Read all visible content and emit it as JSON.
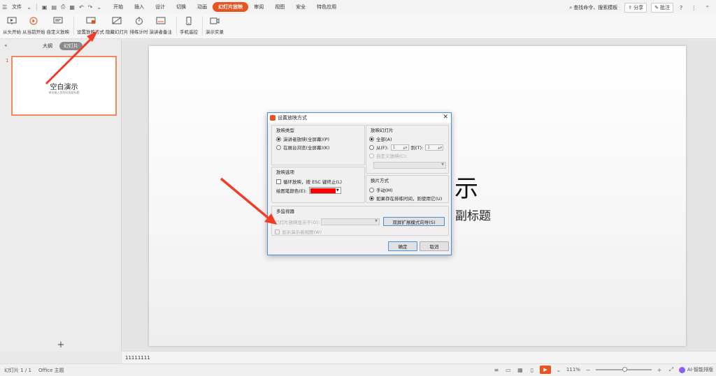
{
  "menubar": {
    "file_label": "文件",
    "tabs": [
      {
        "label": "开始",
        "active": false
      },
      {
        "label": "插入",
        "active": false
      },
      {
        "label": "设计",
        "active": false
      },
      {
        "label": "切换",
        "active": false
      },
      {
        "label": "动画",
        "active": false
      },
      {
        "label": "幻灯片放映",
        "active": true
      },
      {
        "label": "审阅",
        "active": false
      },
      {
        "label": "视图",
        "active": false
      },
      {
        "label": "安全",
        "active": false
      },
      {
        "label": "特色应用",
        "active": false
      }
    ],
    "search_label": "查找命令、搜索模板",
    "share_label": "分享",
    "comment_label": "批注"
  },
  "ribbon": {
    "buttons": [
      {
        "label": "从头开始",
        "icon": "play-from-start-icon"
      },
      {
        "label": "从当前开始",
        "icon": "play-current-icon"
      },
      {
        "label": "自定义放映",
        "icon": "custom-show-icon"
      },
      {
        "label": "设置放映方式",
        "icon": "setup-show-icon"
      },
      {
        "label": "隐藏幻灯片",
        "icon": "hide-slide-icon"
      },
      {
        "label": "排练计时",
        "icon": "rehearse-timer-icon"
      },
      {
        "label": "演讲者备注",
        "icon": "speaker-notes-icon"
      },
      {
        "label": "手机遥控",
        "icon": "phone-remote-icon"
      },
      {
        "label": "演示实录",
        "icon": "record-show-icon"
      }
    ]
  },
  "left_panel": {
    "tabs": [
      {
        "label": "大纲",
        "active": false
      },
      {
        "label": "幻灯片",
        "active": true
      }
    ],
    "slide_number": "1",
    "thumb_title": "空白演示",
    "thumb_subtitle": "单击输入您的封面副标题"
  },
  "slide": {
    "title_visible": "示",
    "subtitle_visible": "副标题"
  },
  "notes_text": "11111111",
  "statusbar": {
    "slide_info": "幻灯片 1 / 1",
    "theme": "Office 主题",
    "zoom": "111%",
    "ai_label": "AI·智能排版"
  },
  "dialog": {
    "title": "设置放映方式",
    "show_type": {
      "title": "放映类型",
      "options": [
        "演讲者放映(全屏幕)(P)",
        "在展台浏览(全屏幕)(K)"
      ],
      "selected": 0
    },
    "show_slides": {
      "title": "放映幻灯片",
      "all_label": "全部(A)",
      "from_label": "从(F):",
      "from_value": "1",
      "to_label": "到(T):",
      "to_value": "1",
      "custom_label": "自定义放映(C):"
    },
    "show_options": {
      "title": "放映选项",
      "loop_label": "循环放映，按 ESC 键终止(L)",
      "pen_color_label": "绘图笔颜色(E):",
      "pen_color": "#ff0000"
    },
    "advance": {
      "title": "换片方式",
      "options": [
        "手动(M)",
        "如果存在排练时间，则使用它(U)"
      ],
      "selected": 1
    },
    "multi_monitor": {
      "title": "多监视器",
      "display_label": "幻灯片放映显示于(O):",
      "presenter_view_label": "显示演示者视图(W)",
      "wizard_button": "双屏扩展模式向导(S)"
    },
    "ok_label": "确定",
    "cancel_label": "取消"
  },
  "colors": {
    "accent": "#e8541e",
    "arrow": "#f03c28"
  }
}
